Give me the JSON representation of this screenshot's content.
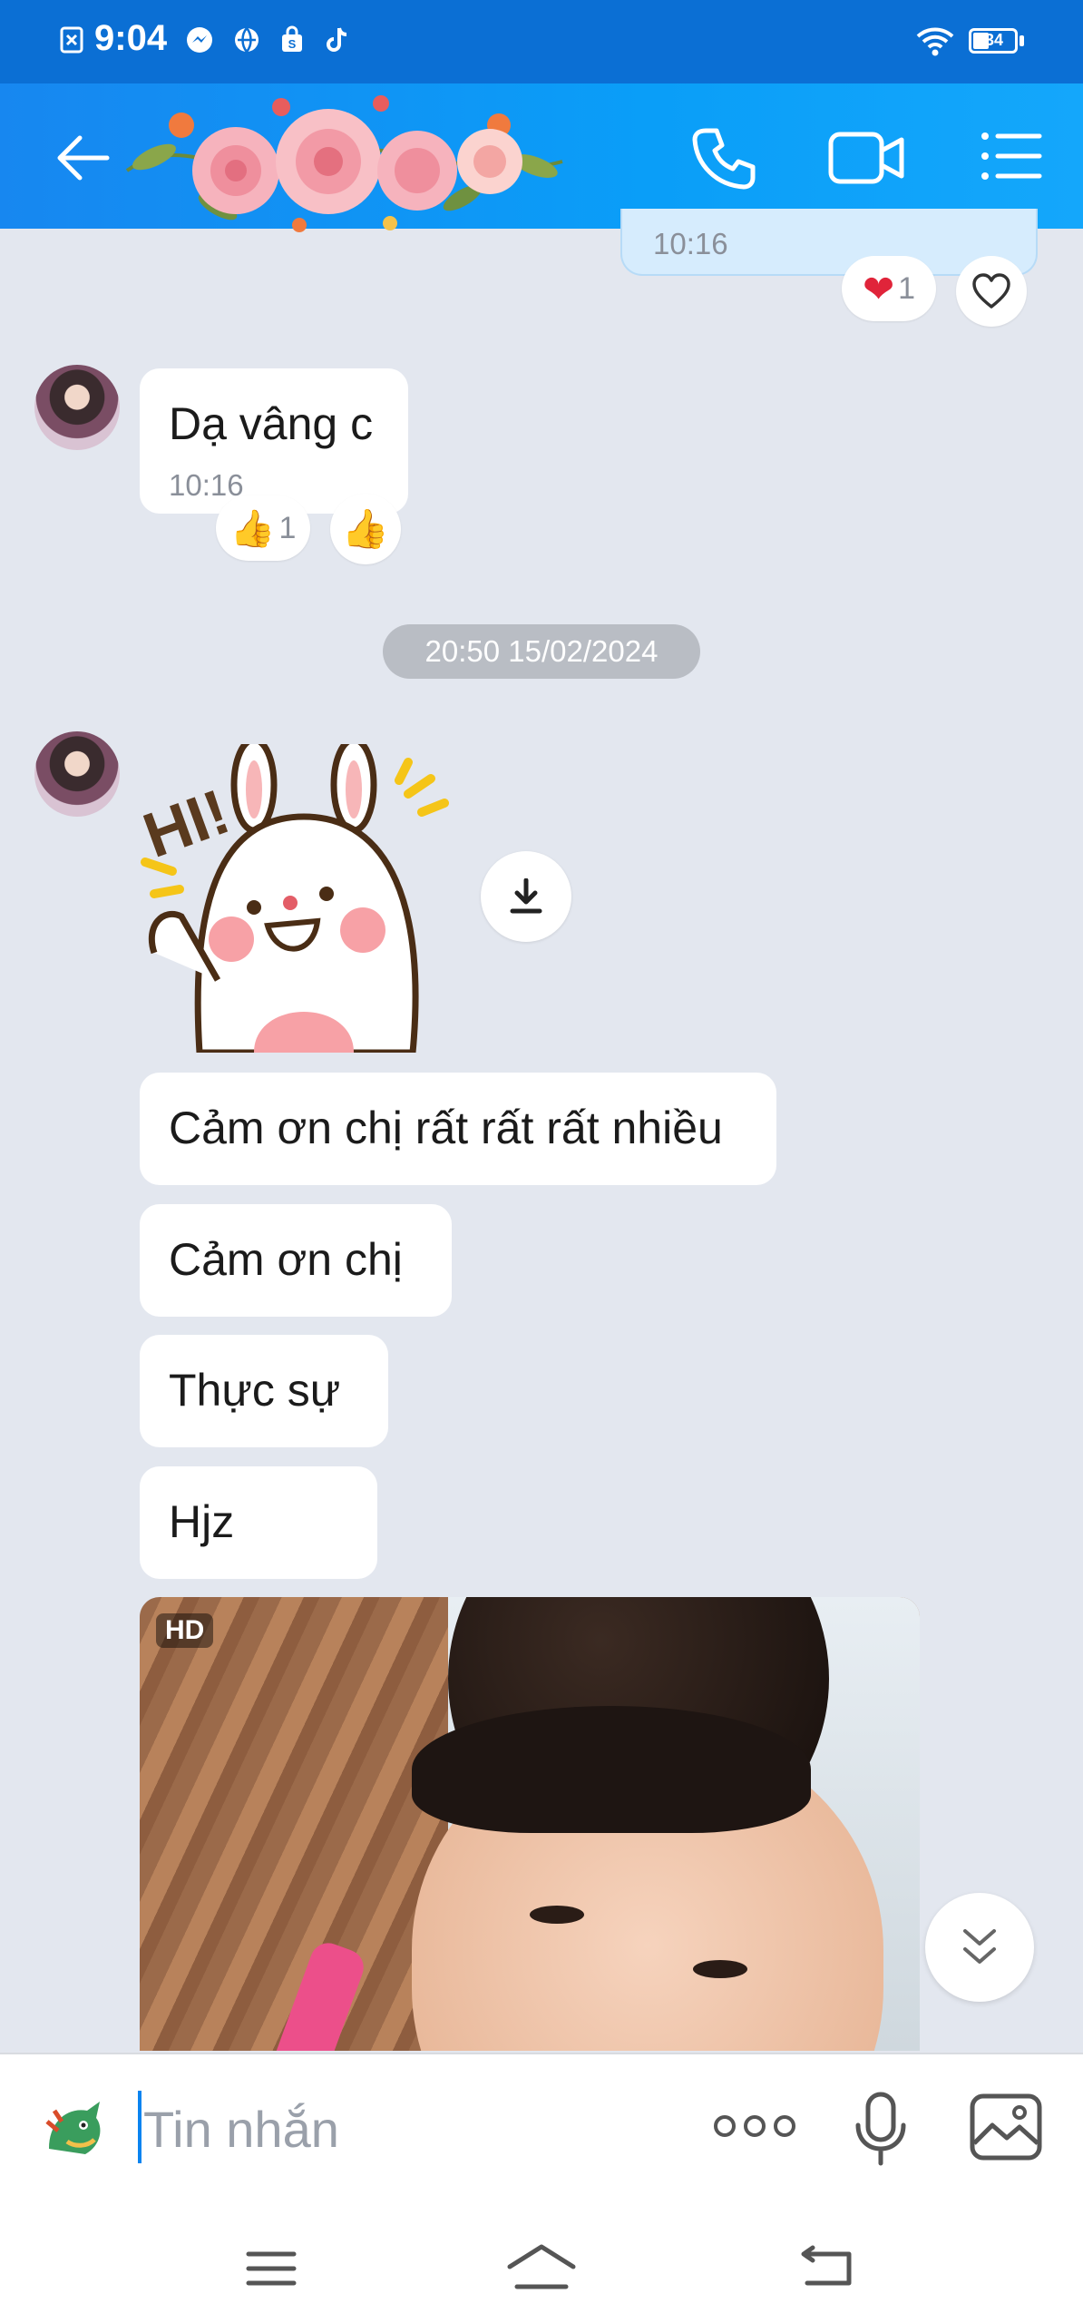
{
  "status_bar": {
    "time": "9:04",
    "battery": "34"
  },
  "header": {
    "back_icon": "arrow-left-icon",
    "call_icon": "phone-icon",
    "video_icon": "video-camera-icon",
    "menu_icon": "list-icon"
  },
  "messages": {
    "prev_timestamp": "10:16",
    "prev_reaction_count": "1",
    "reply": {
      "text": "Dạ vâng c",
      "time": "10:16",
      "reaction_count": "1"
    },
    "date_separator": "20:50 15/02/2024",
    "sticker_text": "HI!",
    "texts": [
      "Cảm ơn chị rất rất rất nhiều",
      "Cảm ơn chị",
      "Thực sự",
      "Hjz"
    ],
    "photo_badge": "HD"
  },
  "input": {
    "placeholder": "Tin nhắn"
  },
  "colors": {
    "accent": "#0a84f0",
    "bubble": "#ffffff",
    "background": "#e3e7ef",
    "reaction_heart": "#e0243a"
  }
}
